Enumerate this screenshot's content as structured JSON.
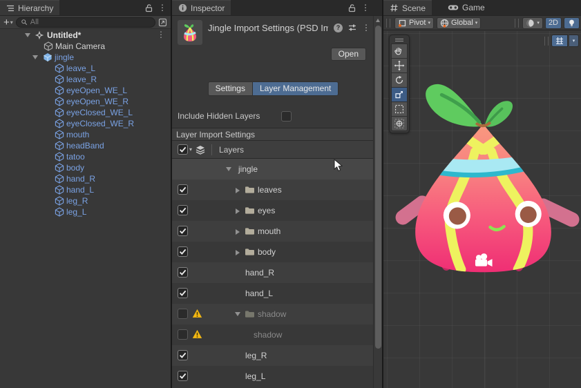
{
  "glyphs": {
    "plus": "+",
    "dropdown": "▾",
    "kebab": "⋮"
  },
  "hierarchy": {
    "tab": "Hierarchy",
    "search_placeholder": "All",
    "items": [
      {
        "label": "Untitled*"
      },
      {
        "label": "Main Camera"
      },
      {
        "label": "jingle"
      },
      {
        "label": "leave_L"
      },
      {
        "label": "leave_R"
      },
      {
        "label": "eyeOpen_WE_L"
      },
      {
        "label": "eyeOpen_WE_R"
      },
      {
        "label": "eyeClosed_WE_L"
      },
      {
        "label": "eyeClosed_WE_R"
      },
      {
        "label": "mouth"
      },
      {
        "label": "headBand"
      },
      {
        "label": "tatoo"
      },
      {
        "label": "body"
      },
      {
        "label": "hand_R"
      },
      {
        "label": "hand_L"
      },
      {
        "label": "leg_R"
      },
      {
        "label": "leg_L"
      }
    ]
  },
  "inspector": {
    "tab": "Inspector",
    "title": "Jingle Import Settings (PSD Imp",
    "open_button": "Open",
    "tab_settings": "Settings",
    "tab_layer_management": "Layer Management",
    "include_hidden_layers_label": "Include Hidden Layers",
    "section_header": "Layer Import Settings",
    "layers_column_header": "Layers",
    "rows": [
      {
        "label": "jingle",
        "checked": null,
        "type": "group-root",
        "expanded": true
      },
      {
        "label": "leaves",
        "checked": true,
        "type": "folder"
      },
      {
        "label": "eyes",
        "checked": true,
        "type": "folder"
      },
      {
        "label": "mouth",
        "checked": true,
        "type": "folder"
      },
      {
        "label": "body",
        "checked": true,
        "type": "folder"
      },
      {
        "label": "hand_R",
        "checked": true,
        "type": "layer"
      },
      {
        "label": "hand_L",
        "checked": true,
        "type": "layer"
      },
      {
        "label": "shadow",
        "checked": false,
        "type": "folder",
        "warning": true,
        "expanded": true
      },
      {
        "label": "shadow",
        "checked": false,
        "type": "child-layer",
        "warning": true
      },
      {
        "label": "leg_R",
        "checked": true,
        "type": "layer"
      },
      {
        "label": "leg_L",
        "checked": true,
        "type": "layer"
      }
    ]
  },
  "scene": {
    "tab_scene": "Scene",
    "tab_game": "Game",
    "toolbar": {
      "pivot_label": "Pivot",
      "global_label": "Global",
      "mode_2d_label": "2D"
    }
  },
  "colors": {
    "accent_blue": "#4d6c92",
    "prefab_text_blue": "#7aa2e4",
    "warning_yellow": "#f2b713",
    "panel_bg": "#383838",
    "sprite_body_top": "#f9997f",
    "sprite_body_bottom": "#ef2e74",
    "sprite_leaf_green": "#5fcb5f",
    "sprite_stripe_yellow": "#eef25f",
    "sprite_headband_blue": "#a9e9f3",
    "sprite_headband_teal": "#2eb8cd"
  }
}
